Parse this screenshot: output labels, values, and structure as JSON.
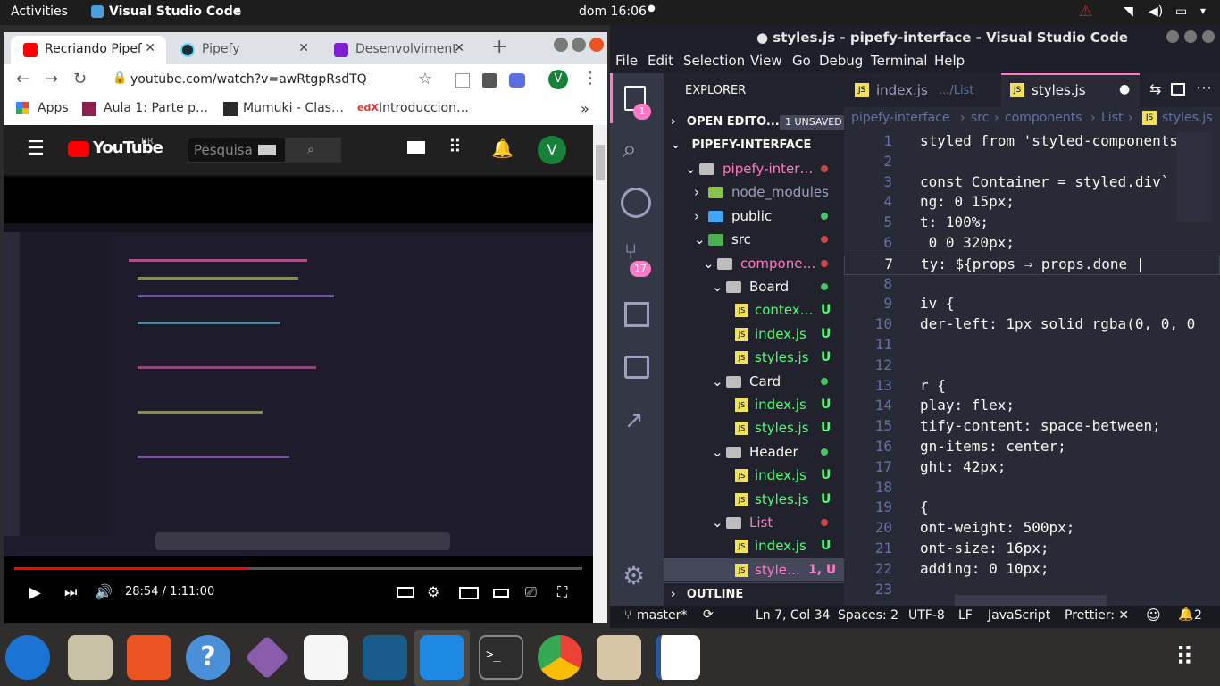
{
  "topbar": {
    "activities": "Activities",
    "app": "Visual Studio Code",
    "clock": "dom 16:06"
  },
  "chrome": {
    "tabs": [
      {
        "title": "Recriando Pipef"
      },
      {
        "title": "Pipefy"
      },
      {
        "title": "Desenvolviment"
      }
    ],
    "url": "youtube.com/watch?v=awRtgpRsdTQ",
    "profile_initial": "V",
    "bookmarks": [
      "Apps",
      "Aula 1: Parte p…",
      "Mumuki - Clas…",
      "Introduccion…"
    ],
    "youtube": {
      "logo": "YouTube",
      "region": "BR",
      "search_placeholder": "Pesquisa",
      "avatar": "V",
      "time": "28:54 / 1:11:00",
      "progress": 0.41
    }
  },
  "vscode": {
    "title": "● styles.js - pipefy-interface - Visual Studio Code",
    "menu": [
      "File",
      "Edit",
      "Selection",
      "View",
      "Go",
      "Debug",
      "Terminal",
      "Help"
    ],
    "explorer_title": "EXPLORER",
    "open_editors": "OPEN EDITO...",
    "unsaved": "1 UNSAVED",
    "project": "PIPEFY-INTERFACE",
    "tree": [
      {
        "label": "pipefy-inter…",
        "badge": ""
      },
      {
        "label": "node_modules",
        "badge": ""
      },
      {
        "label": "public",
        "badge": ""
      },
      {
        "label": "src",
        "badge": ""
      },
      {
        "label": "compone…",
        "badge": ""
      },
      {
        "label": "Board",
        "badge": ""
      },
      {
        "label": "contex…",
        "badge": "U"
      },
      {
        "label": "index.js",
        "badge": "U"
      },
      {
        "label": "styles.js",
        "badge": "U"
      },
      {
        "label": "Card",
        "badge": ""
      },
      {
        "label": "index.js",
        "badge": "U"
      },
      {
        "label": "styles.js",
        "badge": "U"
      },
      {
        "label": "Header",
        "badge": ""
      },
      {
        "label": "index.js",
        "badge": "U"
      },
      {
        "label": "styles.js",
        "badge": "U"
      },
      {
        "label": "List",
        "badge": ""
      },
      {
        "label": "index.js",
        "badge": "U"
      },
      {
        "label": "style…",
        "badge": "1, U"
      }
    ],
    "outline": "OUTLINE",
    "tabs": [
      {
        "name": "index.js",
        "path": ".../List"
      },
      {
        "name": "styles.js",
        "path": ""
      }
    ],
    "breadcrumb": [
      "pipefy-interface",
      "src",
      "components",
      "List",
      "styles.js"
    ],
    "activity_badges": {
      "explorer": "1",
      "scm": "17"
    },
    "code": [
      {
        "n": "1",
        "t": "styled from 'styled-components"
      },
      {
        "n": "2",
        "t": ""
      },
      {
        "n": "3",
        "t": "const Container = styled.div`"
      },
      {
        "n": "4",
        "t": "ng: 0 15px;"
      },
      {
        "n": "5",
        "t": "t: 100%;"
      },
      {
        "n": "6",
        "t": " 0 0 320px;"
      },
      {
        "n": "7",
        "t": "ty: ${props ⇒ props.done |"
      },
      {
        "n": "8",
        "t": ""
      },
      {
        "n": "9",
        "t": "iv {"
      },
      {
        "n": "10",
        "t": "der-left: 1px solid rgba(0, 0, 0"
      },
      {
        "n": "11",
        "t": ""
      },
      {
        "n": "12",
        "t": ""
      },
      {
        "n": "13",
        "t": "r {"
      },
      {
        "n": "14",
        "t": "play: flex;"
      },
      {
        "n": "15",
        "t": "tify-content: space-between;"
      },
      {
        "n": "16",
        "t": "gn-items: center;"
      },
      {
        "n": "17",
        "t": "ght: 42px;"
      },
      {
        "n": "18",
        "t": ""
      },
      {
        "n": "19",
        "t": "{"
      },
      {
        "n": "20",
        "t": "ont-weight: 500px;"
      },
      {
        "n": "21",
        "t": "ont-size: 16px;"
      },
      {
        "n": "22",
        "t": "adding: 0 10px;"
      },
      {
        "n": "23",
        "t": ""
      }
    ],
    "status": {
      "branch": "master*",
      "position": "Ln 7, Col 34",
      "spaces": "Spaces: 2",
      "encoding": "UTF-8",
      "eol": "LF",
      "language": "JavaScript",
      "prettier": "Prettier: ✕",
      "bell": "2"
    }
  },
  "colors": {
    "dracula_bg": "#282a36",
    "accent_pink": "#ff79c6",
    "yt_red": "#ff0000",
    "chrome_green": "#188038"
  }
}
